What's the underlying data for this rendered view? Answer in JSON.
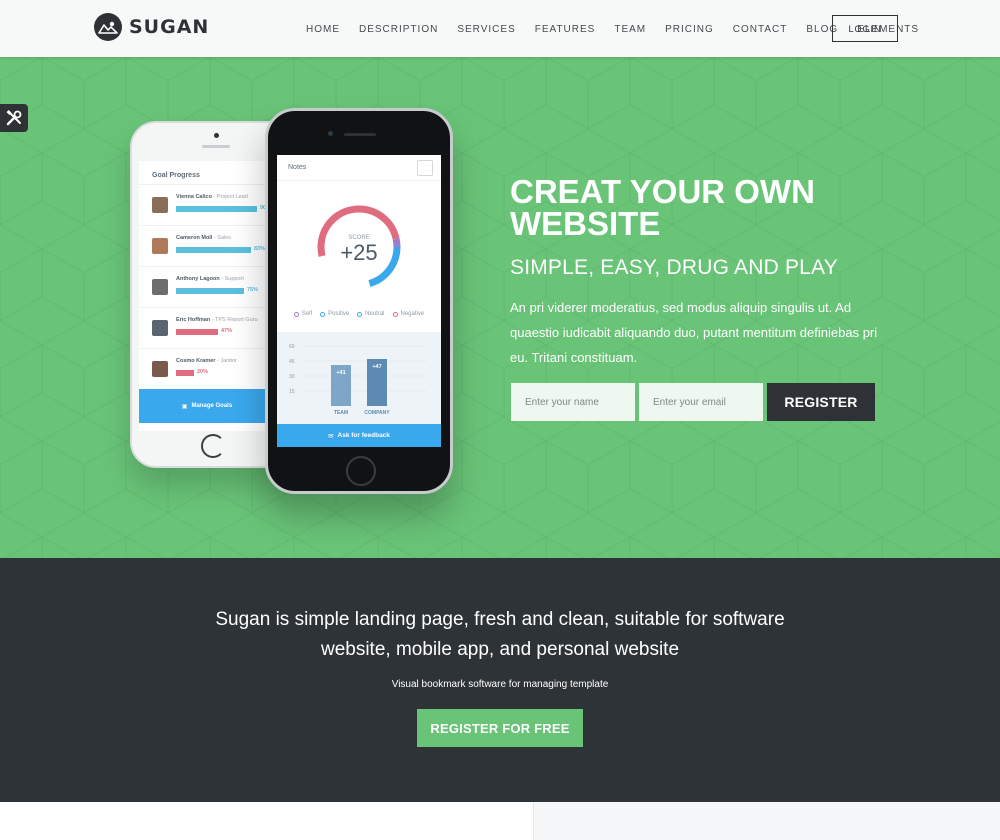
{
  "brand": {
    "name": "SUGAN"
  },
  "nav": {
    "items": [
      "HOME",
      "DESCRIPTION",
      "SERVICES",
      "FEATURES",
      "TEAM",
      "PRICING",
      "CONTACT",
      "BLOG",
      "ELEMENTS"
    ],
    "login_label": "LOGIN"
  },
  "hero": {
    "title": "CREAT YOUR OWN WEBSITE",
    "subtitle": "SIMPLE, EASY, DRUG AND PLAY",
    "body": "An pri viderer moderatius, sed modus aliquip singulis ut. Ad quaestio iudicabit aliquando duo, putant mentitum definiebas pri eu. Tritani constituam.",
    "name_placeholder": "Enter your name",
    "email_placeholder": "Enter your email",
    "register_label": "REGISTER"
  },
  "phone_back": {
    "title": "Goal Progress",
    "people": [
      {
        "name": "Vienna Calico",
        "role": "Project Lead",
        "percent": 90,
        "pct_label": "90",
        "color": "#5bc0de"
      },
      {
        "name": "Cameron Moll",
        "role": "Sales",
        "percent": 83,
        "pct_label": "83%",
        "color": "#5bc0de"
      },
      {
        "name": "Anthony Lagoon",
        "role": "Support",
        "percent": 75,
        "pct_label": "75%",
        "color": "#5bc0de"
      },
      {
        "name": "Eric Hoffman",
        "role": "TPS Report Guru",
        "percent": 47,
        "pct_label": "47%",
        "color": "#e06c7f"
      },
      {
        "name": "Cosmo Kramer",
        "role": "Janitor",
        "percent": 20,
        "pct_label": "20%",
        "color": "#e06c7f"
      }
    ],
    "button_label": "Manage Goals"
  },
  "phone_front": {
    "title": "Notes",
    "score_label": "SCORE",
    "score_value": "+25",
    "legend": [
      {
        "label": "Self",
        "color": "#9b7fcf"
      },
      {
        "label": "Positive",
        "color": "#3aa8ec"
      },
      {
        "label": "Neutral",
        "color": "#3aa8ec"
      },
      {
        "label": "Negative",
        "color": "#e06c7f"
      }
    ],
    "chart": {
      "y_ticks": [
        "60",
        "45",
        "30",
        "15"
      ],
      "bars": [
        {
          "label": "TEAM",
          "value": 41,
          "value_label": "+41"
        },
        {
          "label": "COMPANY",
          "value": 47,
          "value_label": "+47"
        }
      ],
      "ymax": 60
    },
    "button_label": "Ask for feedback"
  },
  "band": {
    "title_line1": "Sugan is simple landing page, fresh and clean, suitable for software",
    "title_line2": "website, mobile app, and personal website",
    "subtitle": "Visual bookmark software for managing template",
    "button_label": "REGISTER FOR FREE"
  },
  "colors": {
    "hero_bg": "#69c478",
    "dark": "#2e3338",
    "accent_blue": "#3aa8ec"
  }
}
